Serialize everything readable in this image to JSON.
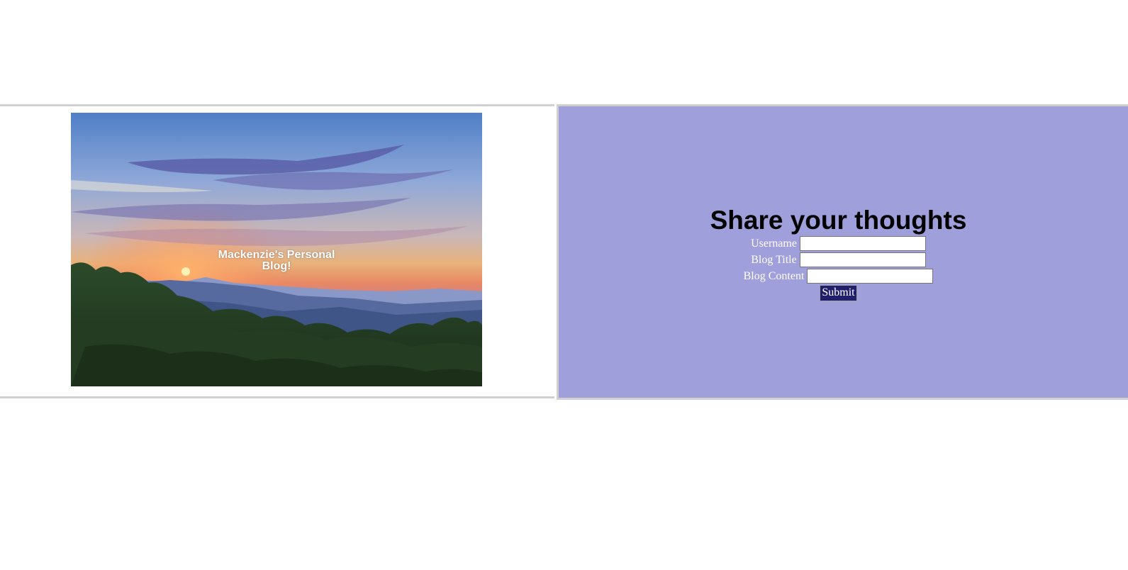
{
  "hero": {
    "caption": "Mackenzie's Personal Blog!",
    "image_alt": "sunset-over-mountains"
  },
  "form": {
    "title": "Share your thoughts",
    "username_label": "Username",
    "blog_title_label": "Blog Title",
    "blog_content_label": "Blog Content",
    "username_value": "",
    "blog_title_value": "",
    "blog_content_value": "",
    "submit_label": "Submit"
  },
  "colors": {
    "form_panel_bg": "#9f9fdb",
    "submit_bg": "#1f1f6b",
    "border": "#d0d0d0"
  }
}
